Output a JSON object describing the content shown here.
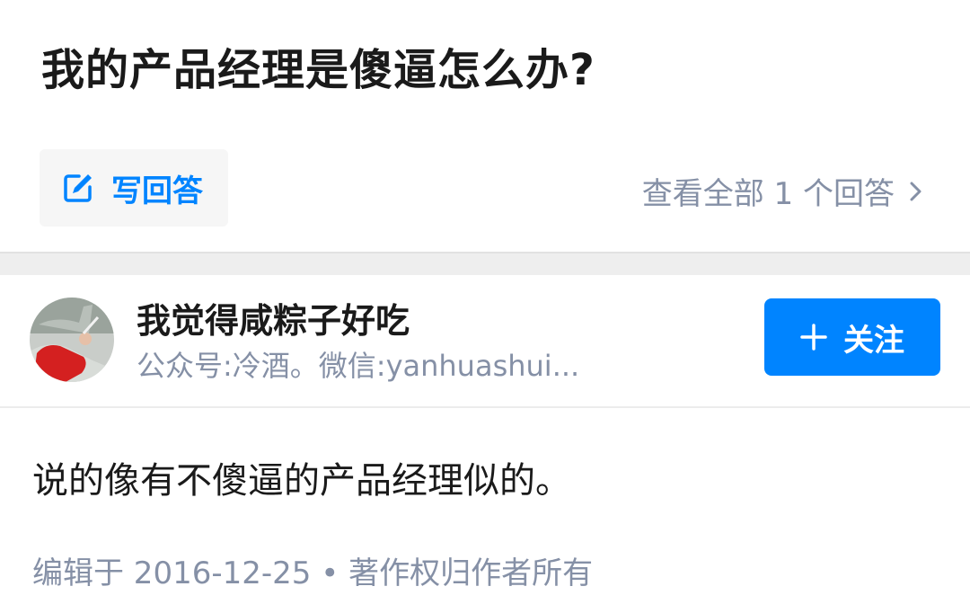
{
  "question": {
    "title": "我的产品经理是傻逼怎么办?",
    "write_answer_label": "写回答",
    "view_all_label": "查看全部 1 个回答"
  },
  "answer": {
    "author_name": "我觉得咸粽子好吃",
    "author_bio": "公众号:冷酒。微信:yanhuashui...",
    "follow_label": "关注",
    "content": "说的像有不傻逼的产品经理似的。",
    "meta": "编辑于 2016-12-25 • 著作权归作者所有"
  },
  "icons": {
    "write": "edit-icon",
    "view_all": "chevron-right-icon",
    "follow": "plus-icon"
  },
  "colors": {
    "accent": "#0084ff",
    "muted_text": "#8590a6",
    "primary_text": "#1a1a1a"
  }
}
